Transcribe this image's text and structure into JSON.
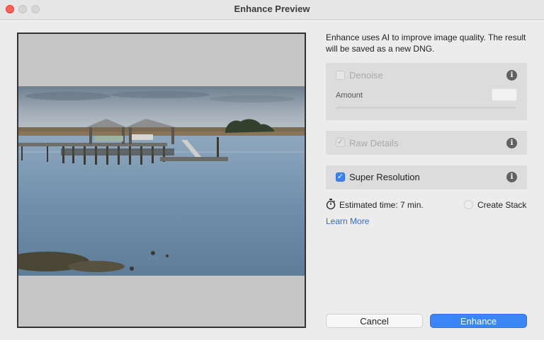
{
  "window": {
    "title": "Enhance Preview"
  },
  "description": "Enhance uses AI to improve image quality. The result will be saved as a new DNG.",
  "options": {
    "denoise": {
      "label": "Denoise",
      "checked": false,
      "enabled": false
    },
    "amount_label": "Amount",
    "raw_details": {
      "label": "Raw Details",
      "checked": true,
      "enabled": false
    },
    "super_resolution": {
      "label": "Super Resolution",
      "checked": true,
      "enabled": true
    }
  },
  "estimate": {
    "text": "Estimated time: 7 min."
  },
  "create_stack": {
    "label": "Create Stack",
    "checked": false
  },
  "learn_more": "Learn More",
  "buttons": {
    "cancel": "Cancel",
    "enhance": "Enhance"
  },
  "colors": {
    "accent": "#3a86f7",
    "close": "#fe5f57",
    "link": "#2d6be0"
  },
  "icons": {
    "info": "info-icon",
    "timer": "stopwatch-icon",
    "check": "checkmark-icon"
  }
}
